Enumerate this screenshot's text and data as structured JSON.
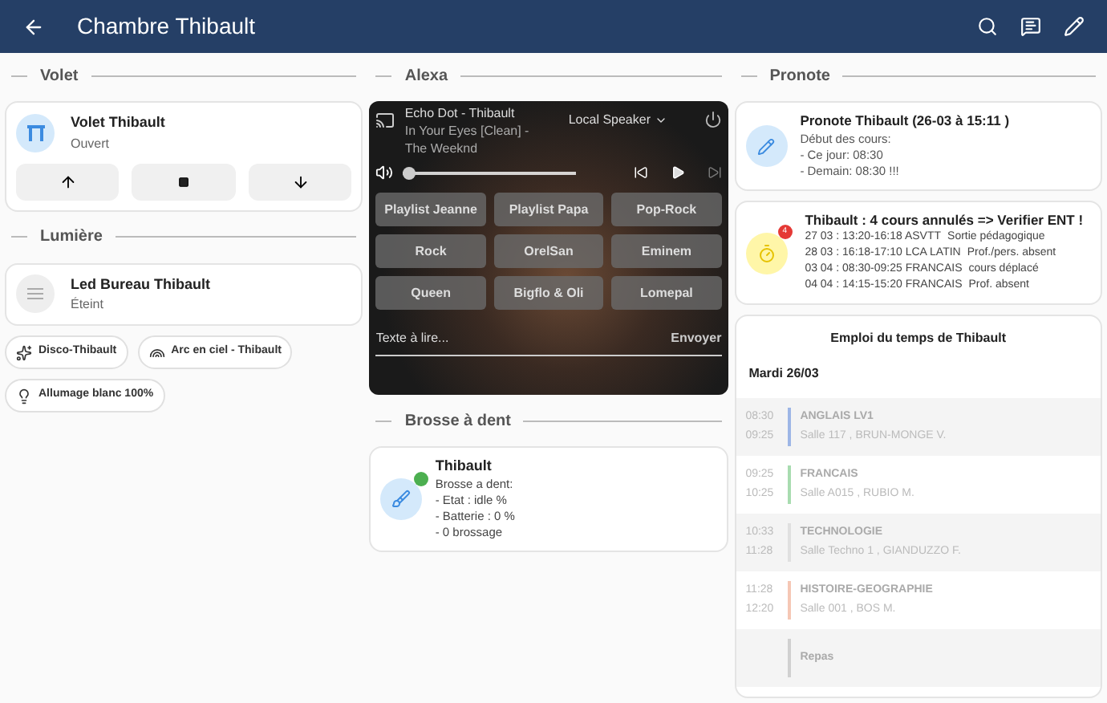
{
  "header": {
    "title": "Chambre Thibault"
  },
  "volet": {
    "section": "Volet",
    "name": "Volet Thibault",
    "state": "Ouvert"
  },
  "lumiere": {
    "section": "Lumière",
    "name": "Led Bureau Thibault",
    "state": "Éteint",
    "on": false,
    "scenes": [
      {
        "label": "Disco-Thibault",
        "kind": "disco"
      },
      {
        "label": "Arc en ciel - Thibault",
        "kind": "rainbow"
      },
      {
        "label": "Allumage blanc 100%",
        "kind": "white"
      }
    ]
  },
  "alexa": {
    "section": "Alexa",
    "device": "Echo Dot - Thibault",
    "track": "In Your Eyes [Clean] - The Weeknd",
    "source": "Local Speaker",
    "volume": {
      "level": 0.0
    },
    "playlists": [
      "Playlist Jeanne",
      "Playlist Papa",
      "Pop-Rock",
      "Rock",
      "OrelSan",
      "Eminem",
      "Queen",
      "Bigflo & Oli",
      "Lomepal"
    ],
    "tts": {
      "placeholder": "Texte à lire...",
      "button": "Envoyer"
    }
  },
  "brosse": {
    "section": "Brosse à dent",
    "name": "Thibault",
    "lines": [
      "Brosse a dent:",
      "- Etat : idle %",
      "- Batterie : 0 %",
      "- 0 brossage"
    ]
  },
  "pronote": {
    "section": "Pronote",
    "title": "Pronote Thibault (26-03 à 15:11 )",
    "lines": [
      "Début des cours:",
      "- Ce jour: 08:30",
      "- Demain: 08:30 !!!"
    ],
    "alert": {
      "title": "Thibault : 4 cours annulés => Verifier ENT !",
      "badge": "4",
      "rows": [
        {
          "when": "27 03 : 13:20-16:18 ASVTT",
          "why": "Sortie pédagogique"
        },
        {
          "when": "28 03 : 16:18-17:10 LCA LATIN",
          "why": "Prof./pers. absent"
        },
        {
          "when": "03 04 : 08:30-09:25 FRANCAIS",
          "why": "cours déplacé"
        },
        {
          "when": "04 04 : 14:15-15:20 FRANCAIS",
          "why": "Prof. absent"
        }
      ]
    },
    "timetable": {
      "title": "Emploi du temps de Thibault",
      "day": "Mardi 26/03",
      "lessons": [
        {
          "start": "08:30",
          "end": "09:25",
          "subject": "ANGLAIS LV1",
          "room": "Salle 117 , BRUN-MONGE V.",
          "color": "#9db6e6"
        },
        {
          "start": "09:25",
          "end": "10:25",
          "subject": "FRANCAIS",
          "room": "Salle A015 , RUBIO M.",
          "color": "#a8dcb0"
        },
        {
          "start": "10:33",
          "end": "11:28",
          "subject": "TECHNOLOGIE",
          "room": "Salle Techno 1 , GIANDUZZO F.",
          "color": "#e0e0e0"
        },
        {
          "start": "11:28",
          "end": "12:20",
          "subject": "HISTOIRE-GEOGRAPHIE",
          "room": "Salle 001 , BOS M.",
          "color": "#f5c7b5"
        },
        {
          "subject": "Repas",
          "color": "#d0d0d0"
        }
      ]
    }
  }
}
